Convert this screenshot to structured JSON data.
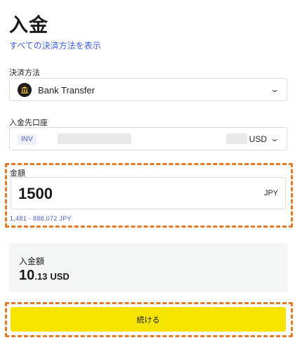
{
  "header": {
    "title": "入金",
    "show_all_methods_link": "すべての決済方法を表示"
  },
  "payment_method": {
    "label": "決済方法",
    "selected": "Bank Transfer",
    "icon": "bank-icon"
  },
  "deposit_account": {
    "label": "入金先口座",
    "badge": "INV",
    "currency": "USD"
  },
  "amount": {
    "label": "金額",
    "value": "1500",
    "currency": "JPY",
    "range": "1,481 - 888,072 JPY"
  },
  "summary": {
    "label": "入金額",
    "value_integer": "10",
    "value_decimal": ".13",
    "currency": "USD"
  },
  "actions": {
    "continue_label": "続ける"
  },
  "colors": {
    "link": "#3b5bdb",
    "highlight_border": "#e07b2a",
    "button": "#f5e500"
  }
}
